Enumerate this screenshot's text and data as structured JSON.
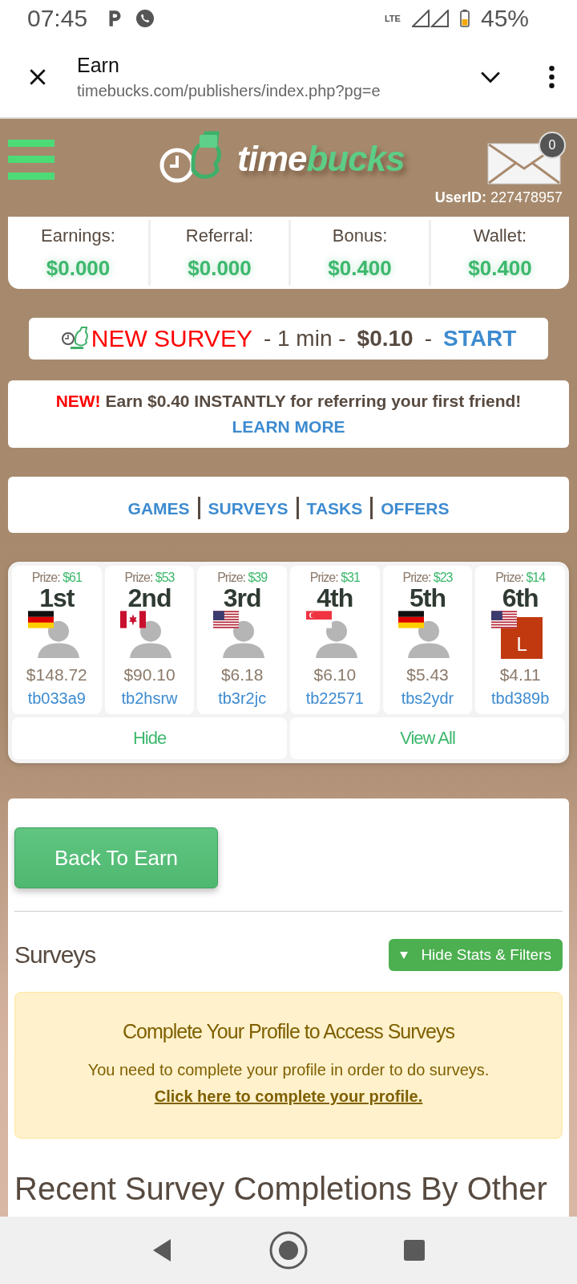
{
  "status_bar": {
    "time": "07:45",
    "network": "LTE",
    "battery": "45%"
  },
  "browser": {
    "title": "Earn",
    "url": "timebucks.com/publishers/index.php?pg=e"
  },
  "header": {
    "logo_first": "time",
    "logo_second": "bucks",
    "mail_count": "0",
    "user_label": "UserID:",
    "user_id": "227478957"
  },
  "stats": [
    {
      "label": "Earnings:",
      "value": "$0.000"
    },
    {
      "label": "Referral:",
      "value": "$0.000"
    },
    {
      "label": "Bonus:",
      "value": "$0.400"
    },
    {
      "label": "Wallet:",
      "value": "$0.400"
    }
  ],
  "survey_banner": {
    "label": "NEW SURVEY",
    "duration": "- 1 min -",
    "price": "$0.10",
    "separator": "-",
    "action": "START"
  },
  "referral": {
    "badge": "NEW!",
    "text": "Earn $0.40 INSTANTLY for referring your first friend!",
    "link": "LEARN MORE"
  },
  "categories": [
    {
      "label": "GAMES"
    },
    {
      "label": "SURVEYS"
    },
    {
      "label": "TASKS"
    },
    {
      "label": "OFFERS"
    }
  ],
  "leaders": [
    {
      "prize_label": "Prize:",
      "prize": "$61",
      "rank": "1st",
      "flag": {
        "kind": "de"
      },
      "avatar": {
        "kind": "silhouette"
      },
      "amount": "$148.72",
      "user": "tb033a9"
    },
    {
      "prize_label": "Prize:",
      "prize": "$53",
      "rank": "2nd",
      "flag": {
        "kind": "ca"
      },
      "avatar": {
        "kind": "silhouette"
      },
      "amount": "$90.10",
      "user": "tb2hsrw"
    },
    {
      "prize_label": "Prize:",
      "prize": "$39",
      "rank": "3rd",
      "flag": {
        "kind": "us"
      },
      "avatar": {
        "kind": "silhouette"
      },
      "amount": "$6.18",
      "user": "tb3r2jc"
    },
    {
      "prize_label": "Prize:",
      "prize": "$31",
      "rank": "4th",
      "flag": {
        "kind": "sg"
      },
      "avatar": {
        "kind": "silhouette"
      },
      "amount": "$6.10",
      "user": "tb22571"
    },
    {
      "prize_label": "Prize:",
      "prize": "$23",
      "rank": "5th",
      "flag": {
        "kind": "de"
      },
      "avatar": {
        "kind": "silhouette"
      },
      "amount": "$5.43",
      "user": "tbs2ydr"
    },
    {
      "prize_label": "Prize:",
      "prize": "$14",
      "rank": "6th",
      "flag": {
        "kind": "us"
      },
      "avatar": {
        "kind": "letter",
        "letter": "L",
        "color": "#c0390f"
      },
      "amount": "$4.11",
      "user": "tbd389b"
    }
  ],
  "leader_buttons": [
    {
      "label": "Hide"
    },
    {
      "label": "View All"
    }
  ],
  "back_button": "Back To Earn",
  "section_title": "Surveys",
  "toggle_button": "Hide Stats & Filters",
  "notice": {
    "title": "Complete Your Profile to Access Surveys",
    "text": "You need to complete your profile in order to do surveys.",
    "link": "Click here to complete your profile."
  },
  "recent_heading": "Recent Survey Completions By Other"
}
